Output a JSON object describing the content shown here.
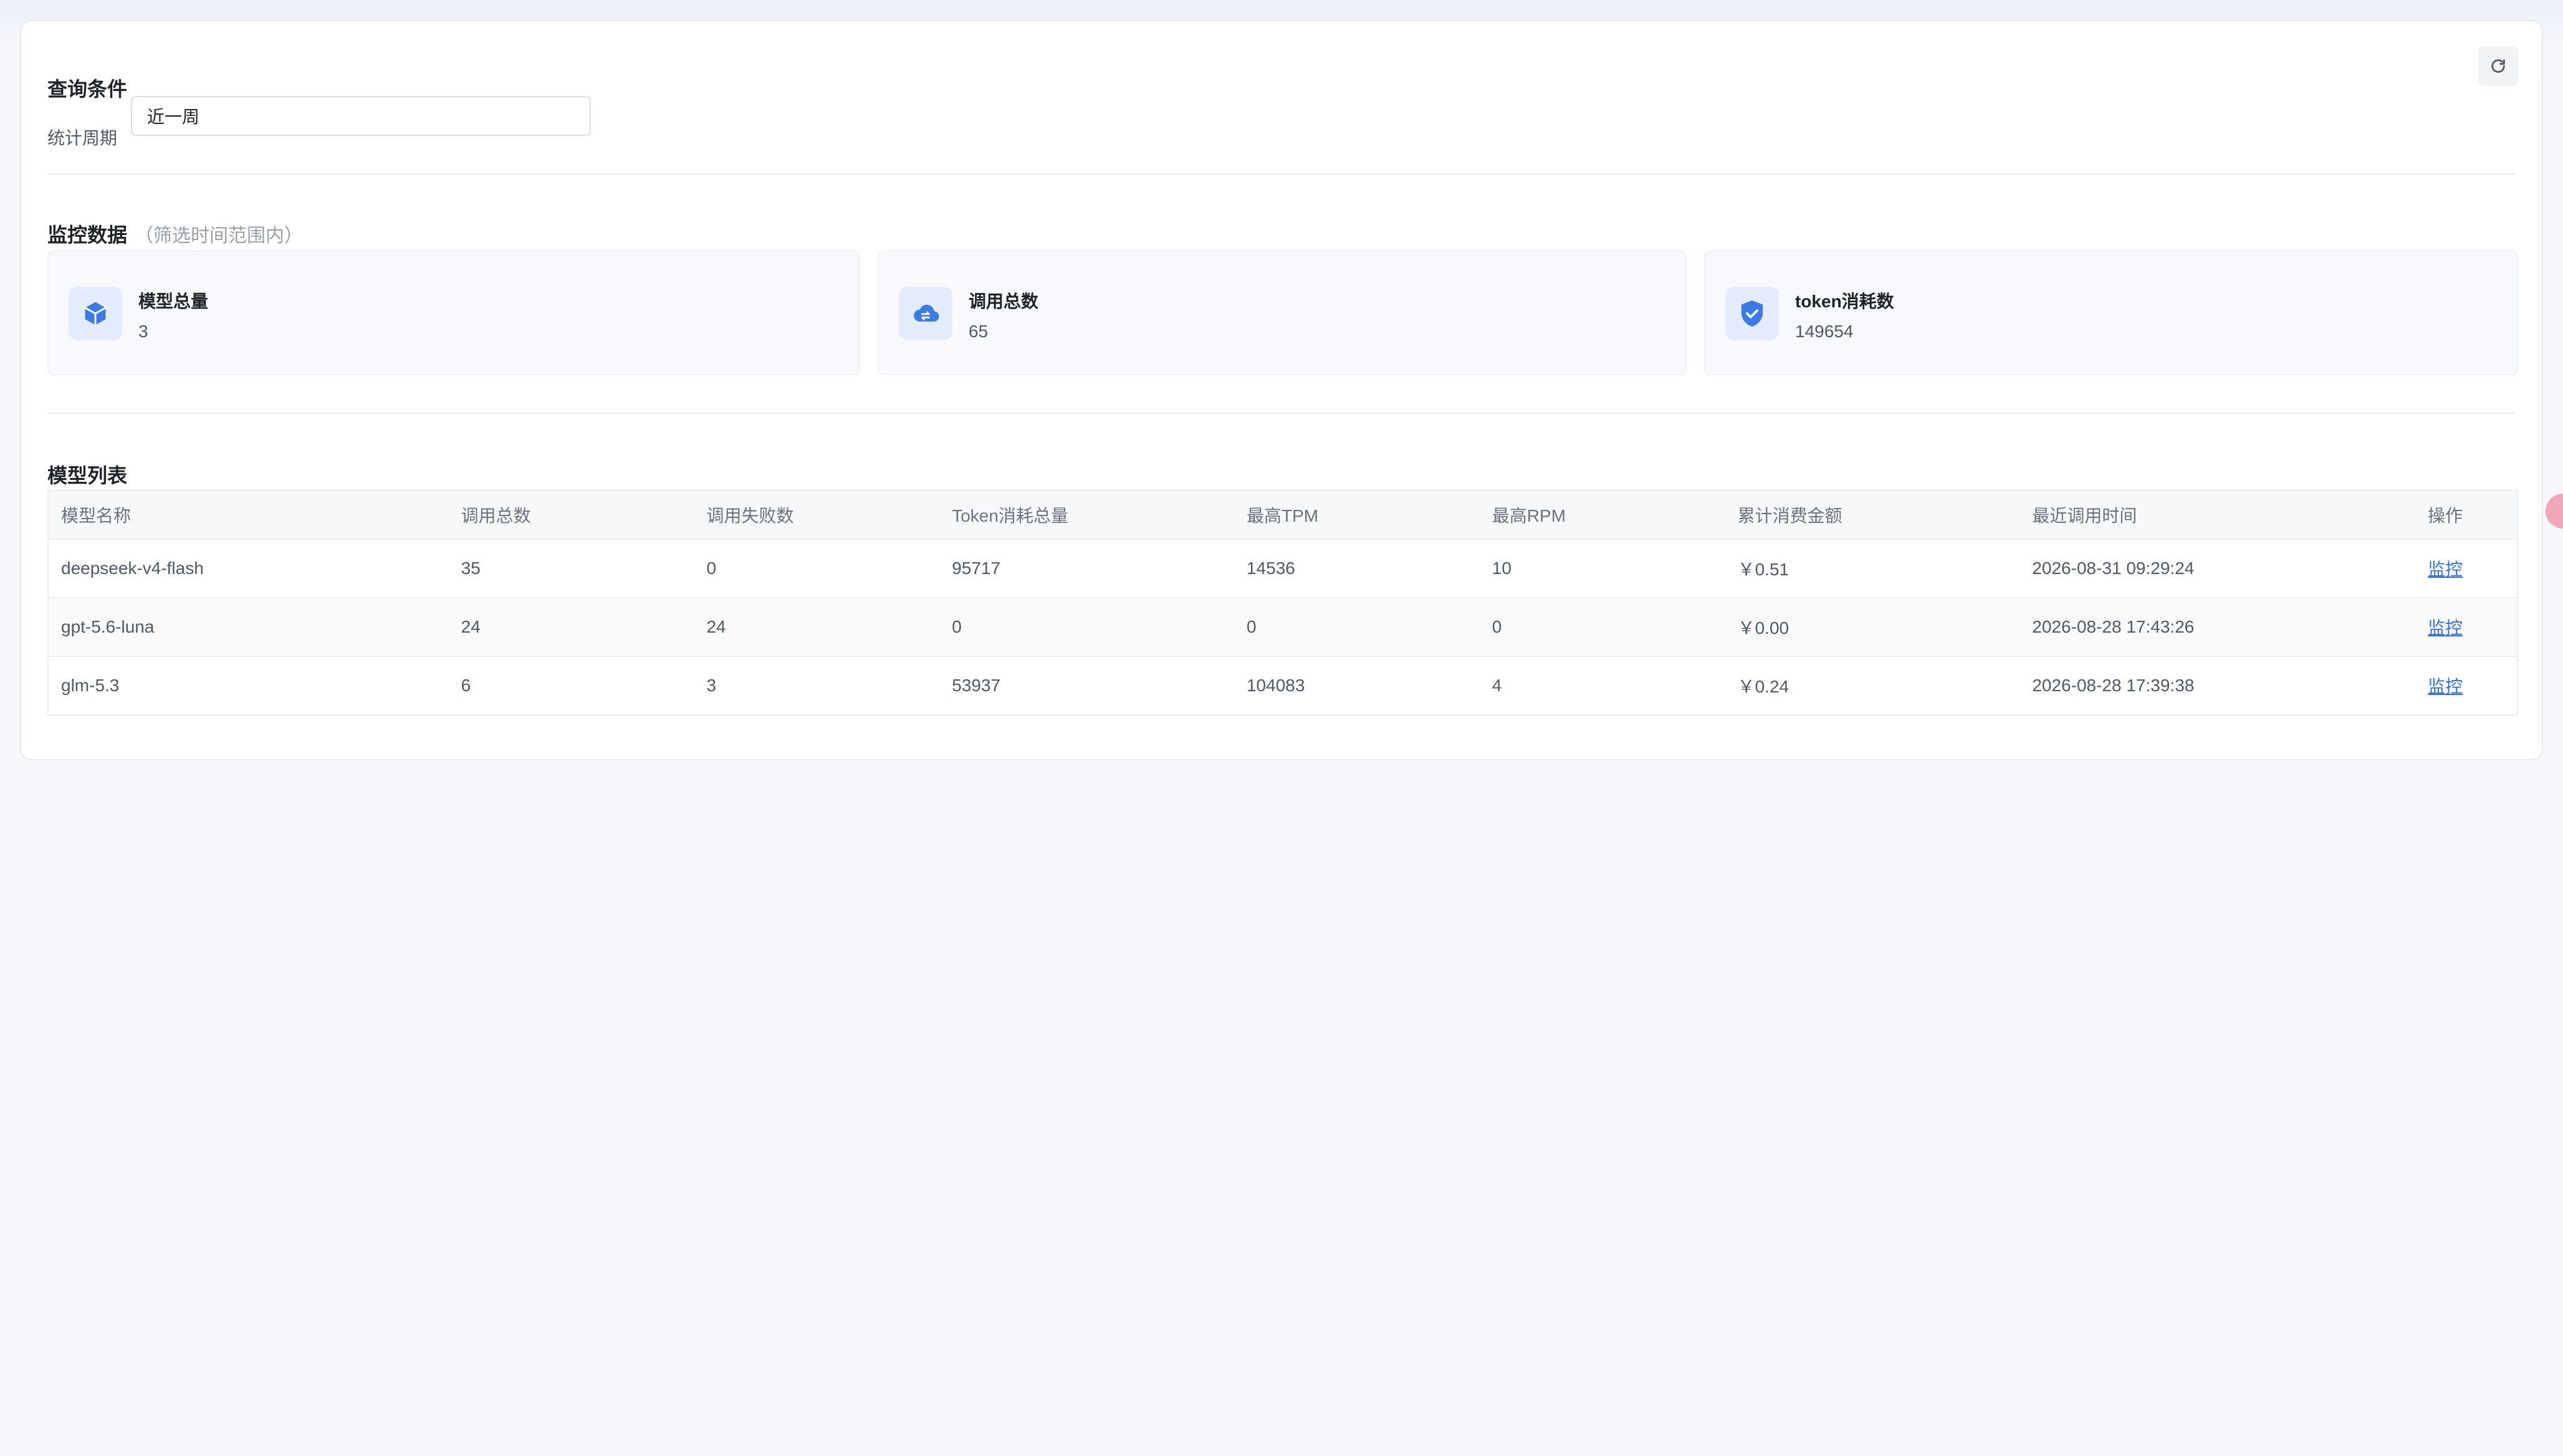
{
  "query": {
    "title": "查询条件",
    "period_label": "统计周期",
    "period_value": "近一周"
  },
  "monitor": {
    "title": "监控数据",
    "hint": "（筛选时间范围内）",
    "cards": [
      {
        "icon": "cube-icon",
        "label": "模型总量",
        "value": "3"
      },
      {
        "icon": "cloud-transfer-icon",
        "label": "调用总数",
        "value": "65"
      },
      {
        "icon": "shield-check-icon",
        "label": "token消耗数",
        "value": "149654"
      }
    ]
  },
  "models": {
    "title": "模型列表",
    "columns": [
      "模型名称",
      "调用总数",
      "调用失败数",
      "Token消耗总量",
      "最高TPM",
      "最高RPM",
      "累计消费金额",
      "最近调用时间",
      "操作"
    ],
    "rows": [
      [
        "deepseek-v4-flash",
        "35",
        "0",
        "95717",
        "14536",
        "10",
        "￥0.51",
        "2026-08-31 09:29:24",
        "监控"
      ],
      [
        "gpt-5.6-luna",
        "24",
        "24",
        "0",
        "0",
        "0",
        "￥0.00",
        "2026-08-28 17:43:26",
        "监控"
      ],
      [
        "glm-5.3",
        "6",
        "3",
        "53937",
        "104083",
        "4",
        "￥0.24",
        "2026-08-28 17:39:38",
        "监控"
      ]
    ]
  },
  "colors": {
    "accent": "#3b7be6",
    "link": "#2f6fe0",
    "icon_bg": "#e4ecfb"
  }
}
